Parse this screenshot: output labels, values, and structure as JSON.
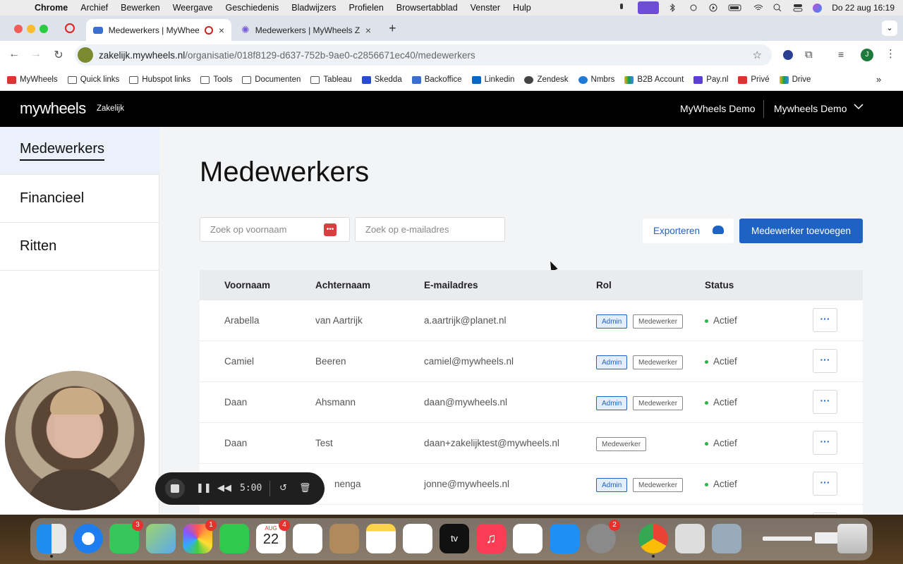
{
  "menubar": {
    "items": [
      "Chrome",
      "Archief",
      "Bewerken",
      "Weergave",
      "Geschiedenis",
      "Bladwijzers",
      "Profielen",
      "Browsertabblad",
      "Venster",
      "Hulp"
    ],
    "datetime": "Do 22 aug  16:19"
  },
  "browser": {
    "tabs": [
      {
        "label": "Medewerkers | MyWheels"
      },
      {
        "label": "Medewerkers | MyWheels Zak"
      }
    ],
    "url_host": "zakelijk.mywheels.nl",
    "url_path": "/organisatie/018f8129-d637-752b-9ae0-c2856671ec40/medewerkers",
    "profile_initial": "J",
    "bookmarks": [
      "MyWheels",
      "Quick links",
      "Hubspot links",
      "Tools",
      "Documenten",
      "Tableau",
      "Skedda",
      "Backoffice",
      "Linkedin",
      "Zendesk",
      "Nmbrs",
      "B2B Account",
      "Pay.nl",
      "Privé",
      "Drive"
    ]
  },
  "header": {
    "logo": "mywheels",
    "logo_sub": "Zakelijk",
    "org1": "MyWheels Demo",
    "org2": "Mywheels Demo"
  },
  "sidebar": {
    "items": [
      {
        "label": "Medewerkers"
      },
      {
        "label": "Financieel"
      },
      {
        "label": "Ritten"
      }
    ]
  },
  "main": {
    "title": "Medewerkers",
    "search_firstname_placeholder": "Zoek op voornaam",
    "search_email_placeholder": "Zoek op e-mailadres",
    "export_label": "Exporteren",
    "add_label": "Medewerker toevoegen"
  },
  "table": {
    "headers": [
      "Voornaam",
      "Achternaam",
      "E-mailadres",
      "Rol",
      "Status"
    ],
    "rows": [
      {
        "first": "Arabella",
        "last": "van Aartrijk",
        "email": "a.aartrijk@planet.nl",
        "roles": [
          "Admin",
          "Medewerker"
        ],
        "status": "Actief"
      },
      {
        "first": "Camiel",
        "last": "Beeren",
        "email": "camiel@mywheels.nl",
        "roles": [
          "Admin",
          "Medewerker"
        ],
        "status": "Actief"
      },
      {
        "first": "Daan",
        "last": "Ahsmann",
        "email": "daan@mywheels.nl",
        "roles": [
          "Admin",
          "Medewerker"
        ],
        "status": "Actief"
      },
      {
        "first": "Daan",
        "last": "Test",
        "email": "daan+zakelijktest@mywheels.nl",
        "roles": [
          "Medewerker"
        ],
        "status": "Actief"
      },
      {
        "first": "",
        "last": "nenga",
        "email": "jonne@mywheels.nl",
        "roles": [
          "Admin",
          "Medewerker"
        ],
        "status": "Actief"
      }
    ],
    "more_label": "···"
  },
  "recorder": {
    "time": "5:00"
  },
  "dock": {
    "badges": {
      "messages": "3",
      "photos": "1",
      "calendar": "4",
      "settings": "2"
    },
    "calendar_month": "AUG",
    "calendar_day": "22"
  },
  "colors": {
    "accent": "#1e63c3",
    "status_active": "#2db24a",
    "header_bg": "#000000"
  }
}
